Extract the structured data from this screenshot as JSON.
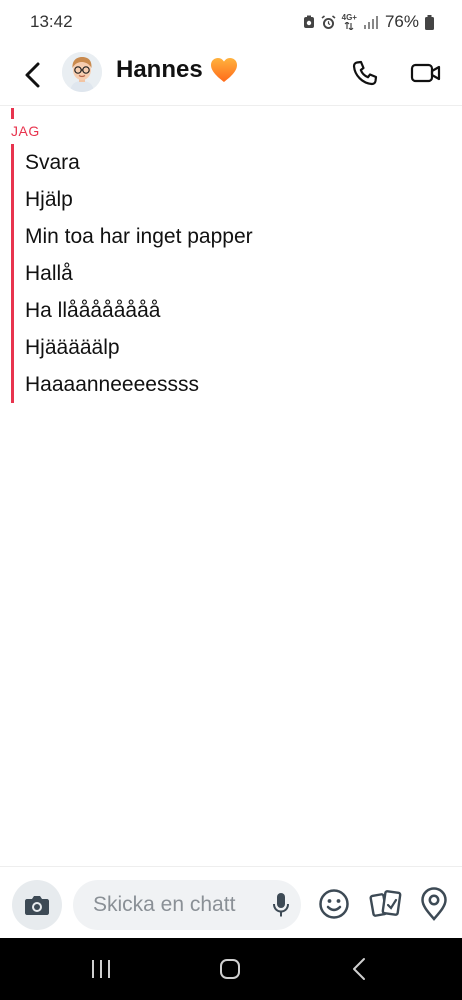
{
  "status_bar": {
    "time": "13:42",
    "network": "4G+",
    "battery": "76%",
    "icons": [
      "screenshot-icon",
      "alarm-icon",
      "network-icon",
      "signal-icon",
      "battery-icon"
    ]
  },
  "header": {
    "contact_name": "Hannes",
    "badge_icon": "orange-heart-icon",
    "icons": [
      "back-icon",
      "avatar",
      "phone-icon",
      "video-icon"
    ]
  },
  "chat": {
    "sender_label": "JAG",
    "accent_color": "#e8344e",
    "messages": [
      "Svara",
      "Hjälp",
      "Min toa har inget papper",
      "Hallå",
      "Ha llåååååååå",
      "Hjääääälp",
      "Haaaanneeeessss"
    ]
  },
  "input_bar": {
    "placeholder": "Skicka en chatt",
    "icons": [
      "camera-icon",
      "mic-icon",
      "emoji-icon",
      "stickers-icon",
      "location-icon"
    ]
  },
  "nav_bar": {
    "icons": [
      "recent-apps-icon",
      "home-icon",
      "nav-back-icon"
    ]
  }
}
